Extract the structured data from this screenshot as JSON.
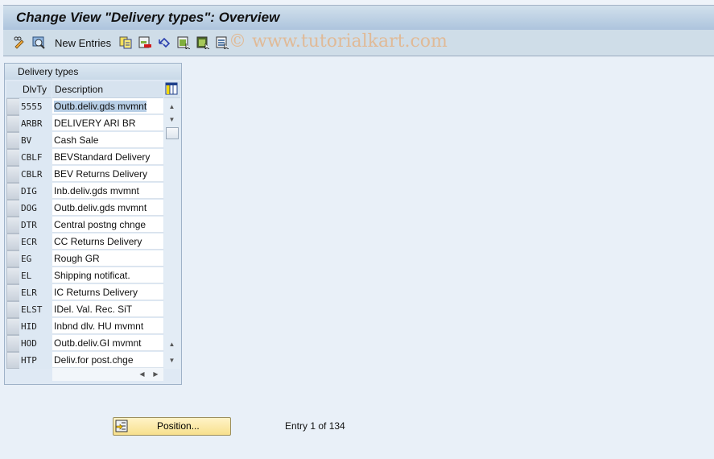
{
  "window": {
    "title": "Change View \"Delivery types\": Overview"
  },
  "toolbar": {
    "items": [
      {
        "icon": "display-change-icon"
      },
      {
        "icon": "find-icon"
      },
      {
        "label": "New Entries"
      },
      {
        "icon": "copy-as-icon"
      },
      {
        "icon": "delete-icon"
      },
      {
        "icon": "undo-change-icon"
      },
      {
        "icon": "select-all-icon"
      },
      {
        "icon": "select-block-icon"
      },
      {
        "icon": "deselect-all-icon"
      }
    ],
    "new_entries_label": "New Entries",
    "watermark": "© www.tutorialkart.com"
  },
  "table": {
    "title": "Delivery types",
    "columns": [
      "DlvTy",
      "Description"
    ],
    "rows": [
      {
        "code": "5555",
        "desc": "Outb.deliv.gds mvmnt"
      },
      {
        "code": "ARBR",
        "desc": "DELIVERY ARI BR"
      },
      {
        "code": "BV",
        "desc": "Cash Sale"
      },
      {
        "code": "CBLF",
        "desc": "BEVStandard Delivery"
      },
      {
        "code": "CBLR",
        "desc": "BEV Returns Delivery"
      },
      {
        "code": "DIG",
        "desc": "Inb.deliv.gds mvmnt"
      },
      {
        "code": "DOG",
        "desc": "Outb.deliv.gds mvmnt"
      },
      {
        "code": "DTR",
        "desc": "Central postng chnge"
      },
      {
        "code": "ECR",
        "desc": "CC Returns Delivery"
      },
      {
        "code": "EG",
        "desc": "Rough GR"
      },
      {
        "code": "EL",
        "desc": "Shipping notificat."
      },
      {
        "code": "ELR",
        "desc": "IC Returns Delivery"
      },
      {
        "code": "ELST",
        "desc": "IDel. Val. Rec. SiT"
      },
      {
        "code": "HID",
        "desc": "Inbnd dlv. HU mvmnt"
      },
      {
        "code": "HOD",
        "desc": "Outb.deliv.GI mvmnt"
      },
      {
        "code": "HTP",
        "desc": "Deliv.for post.chge"
      }
    ]
  },
  "footer": {
    "position_label": "Position...",
    "entry_text": "Entry 1 of 134"
  },
  "colors": {
    "title_bg": "#adc4dd",
    "toolbar_bg": "#cfdde8",
    "button_bg": "#f7e08d",
    "selection": "#b8cfe6",
    "watermark": "#e3b58a"
  }
}
